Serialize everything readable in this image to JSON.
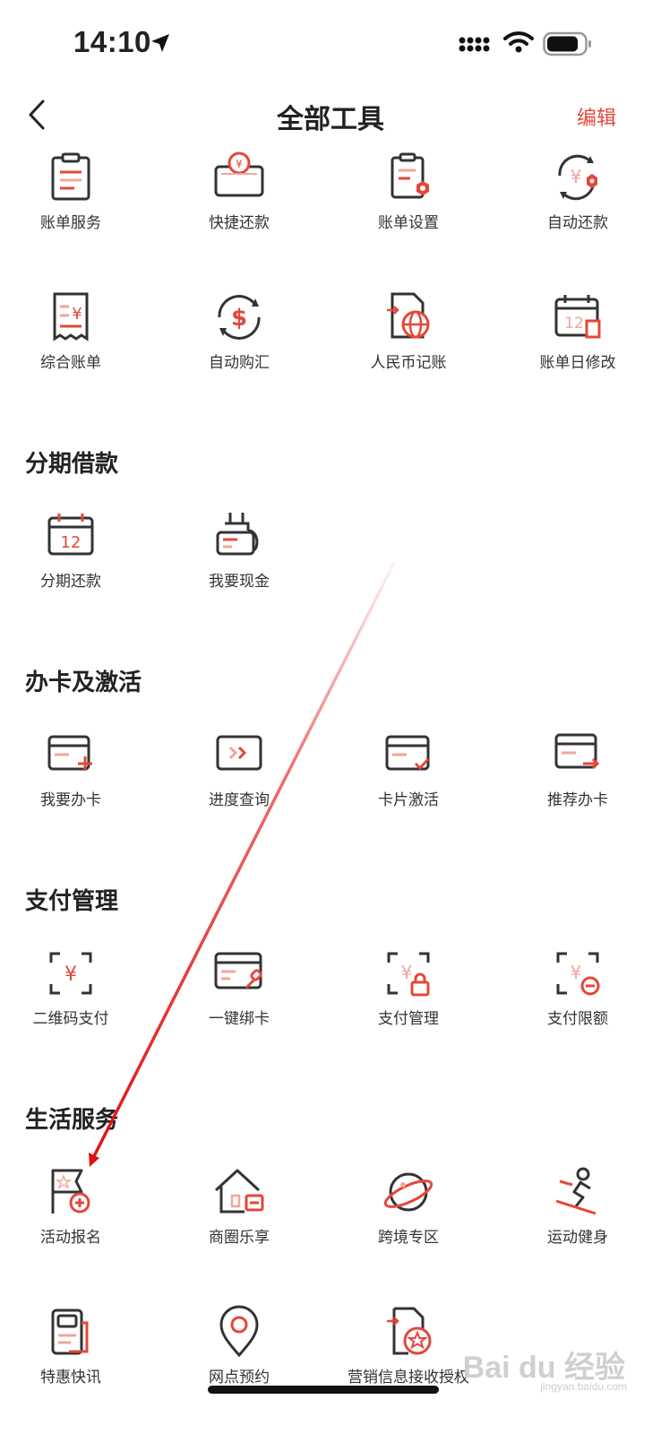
{
  "status": {
    "time": "14:10"
  },
  "nav": {
    "title": "全部工具",
    "edit_label": "编辑"
  },
  "sections": [
    {
      "title": "",
      "items": [
        {
          "label": "账单服务",
          "icon": "bill-clipboard-icon"
        },
        {
          "label": "快捷还款",
          "icon": "quick-repay-icon"
        },
        {
          "label": "账单设置",
          "icon": "bill-settings-icon"
        },
        {
          "label": "自动还款",
          "icon": "auto-repay-icon"
        },
        {
          "label": "综合账单",
          "icon": "receipt-icon"
        },
        {
          "label": "自动购汇",
          "icon": "auto-exchange-icon"
        },
        {
          "label": "人民币记账",
          "icon": "rmb-bookkeeping-icon"
        },
        {
          "label": "账单日修改",
          "icon": "bill-date-edit-icon"
        }
      ]
    },
    {
      "title": "分期借款",
      "items": [
        {
          "label": "分期还款",
          "icon": "calendar-icon"
        },
        {
          "label": "我要现金",
          "icon": "cash-icon"
        }
      ]
    },
    {
      "title": "办卡及激活",
      "items": [
        {
          "label": "我要办卡",
          "icon": "card-add-icon"
        },
        {
          "label": "进度查询",
          "icon": "progress-query-icon"
        },
        {
          "label": "卡片激活",
          "icon": "card-activate-icon"
        },
        {
          "label": "推荐办卡",
          "icon": "card-recommend-icon"
        }
      ]
    },
    {
      "title": "支付管理",
      "items": [
        {
          "label": "二维码支付",
          "icon": "qr-pay-icon"
        },
        {
          "label": "一键绑卡",
          "icon": "bind-card-icon"
        },
        {
          "label": "支付管理",
          "icon": "pay-manage-icon"
        },
        {
          "label": "支付限额",
          "icon": "pay-limit-icon"
        }
      ]
    },
    {
      "title": "生活服务",
      "items": [
        {
          "label": "活动报名",
          "icon": "activity-flag-icon"
        },
        {
          "label": "商圈乐享",
          "icon": "shopping-house-icon"
        },
        {
          "label": "跨境专区",
          "icon": "planet-icon"
        },
        {
          "label": "运动健身",
          "icon": "skiing-icon"
        },
        {
          "label": "特惠快讯",
          "icon": "news-icon"
        },
        {
          "label": "网点预约",
          "icon": "location-pin-icon"
        },
        {
          "label": "营销信息接收授权",
          "icon": "marketing-auth-icon"
        }
      ]
    }
  ],
  "watermark": {
    "brand": "Bai du 经验",
    "url": "jingyan.baidu.com"
  },
  "colors": {
    "accent": "#e4473a",
    "ink": "#333333",
    "arrow": "#e01010"
  }
}
